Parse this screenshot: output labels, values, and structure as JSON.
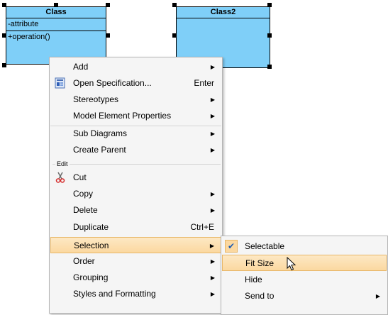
{
  "diagram": {
    "class1": {
      "name": "Class",
      "attribute": "-attribute",
      "operation": "+operation()"
    },
    "class2": {
      "name": "Class2"
    }
  },
  "context_menu": {
    "items": [
      {
        "label": "Add",
        "has_submenu": true
      },
      {
        "label": "Open Specification...",
        "shortcut": "Enter",
        "icon": "specification-icon"
      },
      {
        "label": "Stereotypes",
        "has_submenu": true
      },
      {
        "label": "Model Element Properties",
        "has_submenu": true
      },
      {
        "label": "Sub Diagrams",
        "has_submenu": true
      },
      {
        "label": "Create Parent",
        "has_submenu": true
      },
      {
        "label": "Cut",
        "icon": "scissors-icon"
      },
      {
        "label": "Copy",
        "has_submenu": true
      },
      {
        "label": "Delete",
        "has_submenu": true
      },
      {
        "label": "Duplicate",
        "shortcut": "Ctrl+E"
      },
      {
        "label": "Selection",
        "has_submenu": true,
        "highlighted": true
      },
      {
        "label": "Order",
        "has_submenu": true
      },
      {
        "label": "Grouping",
        "has_submenu": true
      },
      {
        "label": "Styles and Formatting",
        "has_submenu": true
      }
    ],
    "group_edit": "Edit",
    "arrow_glyph": "▶"
  },
  "selection_submenu": {
    "items": [
      {
        "label": "Selectable",
        "checked": true
      },
      {
        "label": "Fit Size",
        "highlighted": true
      },
      {
        "label": "Hide"
      },
      {
        "label": "Send to",
        "has_submenu": true
      }
    ],
    "check_glyph": "✔"
  },
  "colors": {
    "class_fill": "#7fcff8",
    "menu_bg": "#f5f5f5",
    "highlight": "#fbd8a0",
    "highlight_border": "#e8b768"
  }
}
